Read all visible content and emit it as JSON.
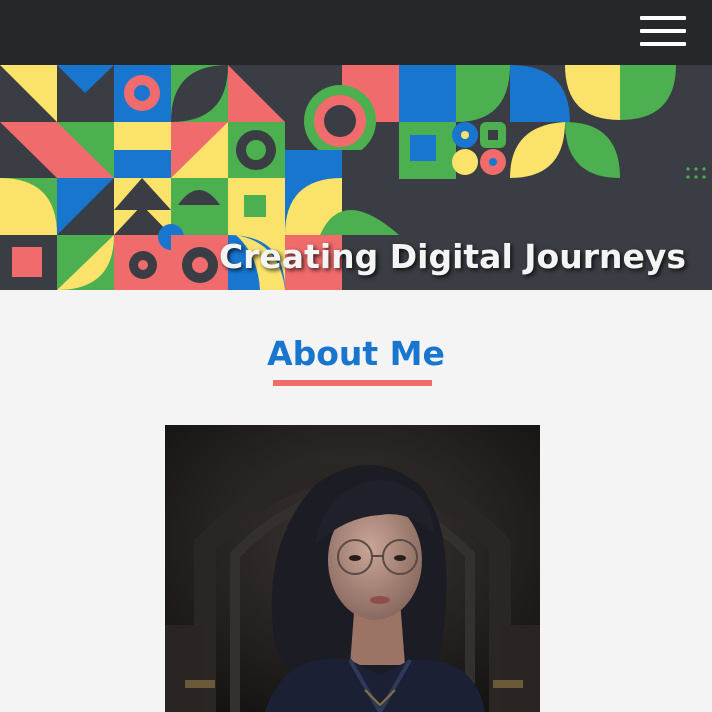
{
  "header": {
    "menu_icon": "hamburger-menu-icon",
    "background_color": "#25272b"
  },
  "banner": {
    "title": "Creating Digital Journeys",
    "pattern_colors": [
      "#fbe36b",
      "#f06b6b",
      "#4caf50",
      "#1976cf",
      "#3a3d44"
    ]
  },
  "about": {
    "heading": "About Me",
    "heading_color": "#1976cf",
    "underline_color": "#f06b6b"
  }
}
